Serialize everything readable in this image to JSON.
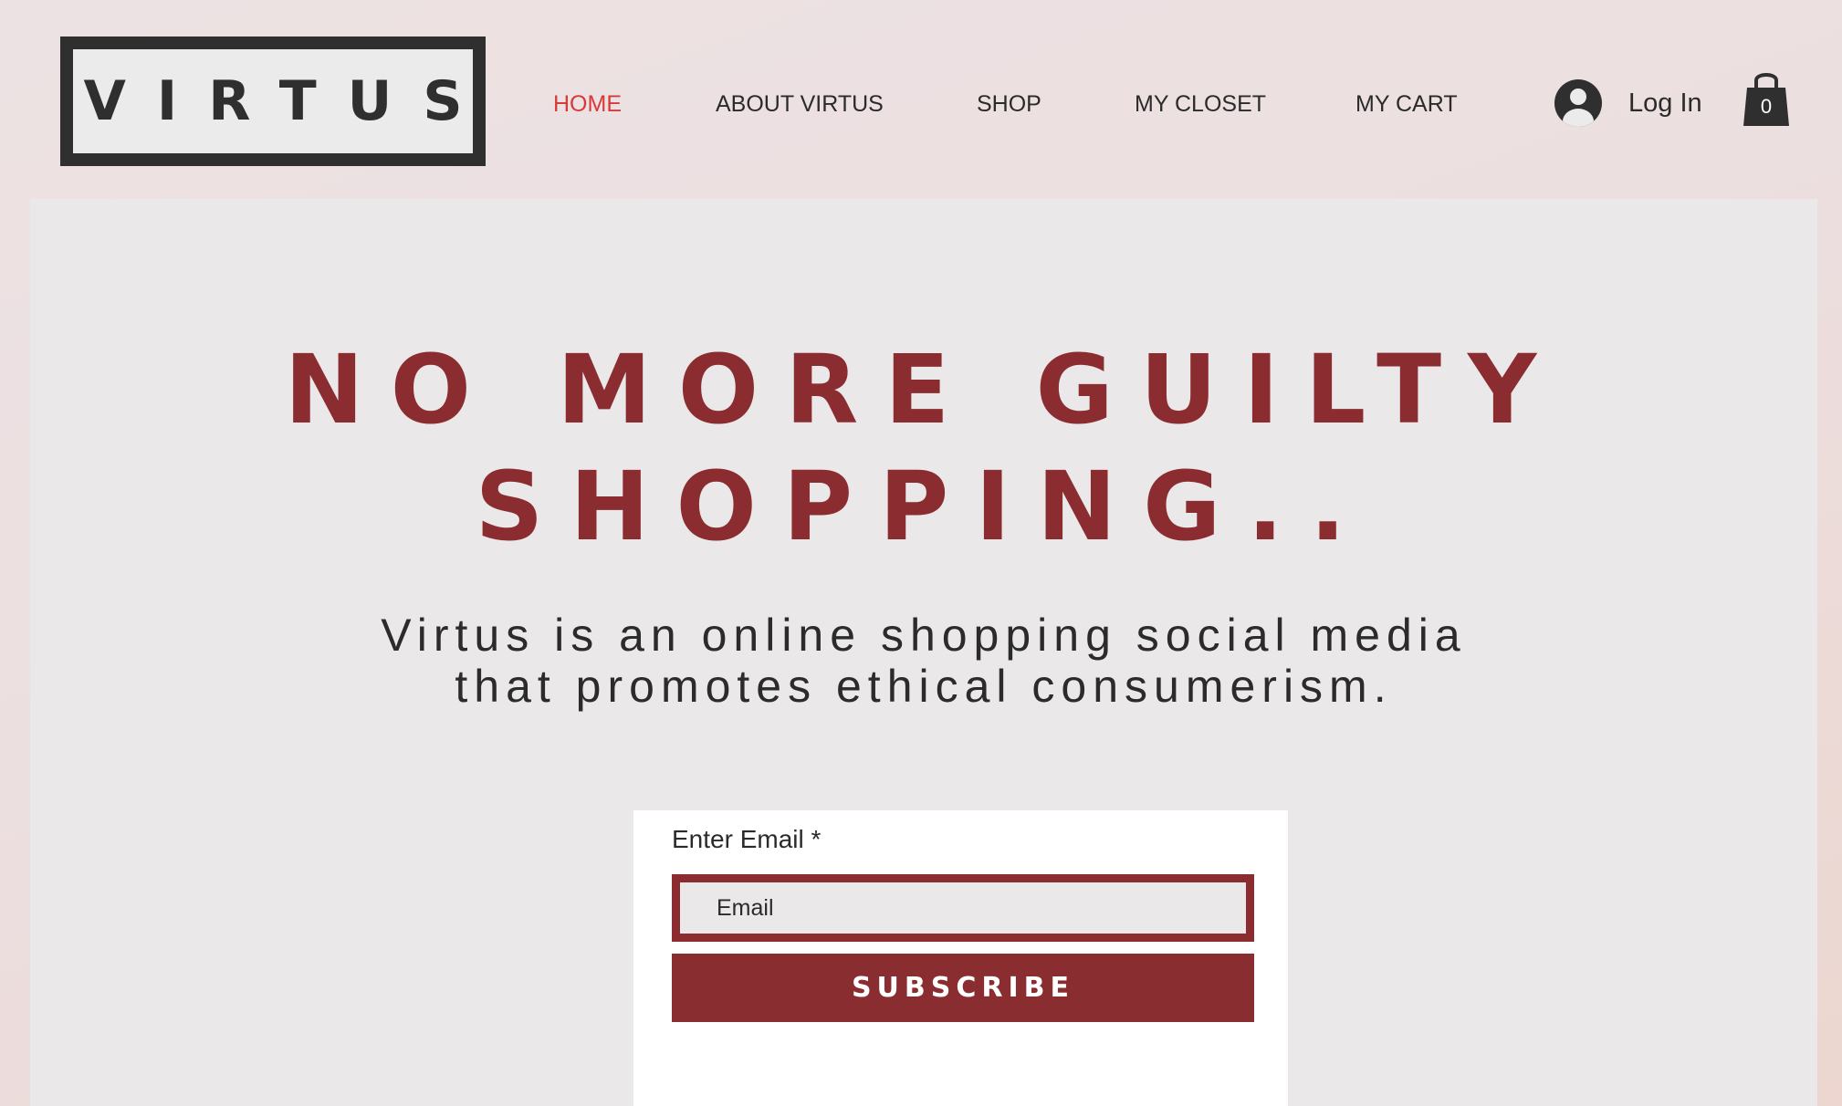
{
  "header": {
    "logo_text": "VIRTUS",
    "nav": [
      {
        "label": "HOME",
        "active": true
      },
      {
        "label": "ABOUT VIRTUS",
        "active": false
      },
      {
        "label": "SHOP",
        "active": false
      },
      {
        "label": "MY CLOSET",
        "active": false
      },
      {
        "label": "MY CART",
        "active": false
      }
    ],
    "login_label": "Log In",
    "cart_count": "0"
  },
  "hero": {
    "headline_line1": "NO MORE GUILTY",
    "headline_line2": "SHOPPING..",
    "subtitle_line1": "Virtus is an online shopping social media",
    "subtitle_line2": "that promotes ethical consumerism."
  },
  "signup": {
    "label": "Enter Email *",
    "placeholder": "Email",
    "button_label": "SUBSCRIBE"
  },
  "colors": {
    "accent": "#8b2d30",
    "active_nav": "#d63a3a",
    "dark": "#2f2f2f",
    "panel": "#eae8e9"
  }
}
